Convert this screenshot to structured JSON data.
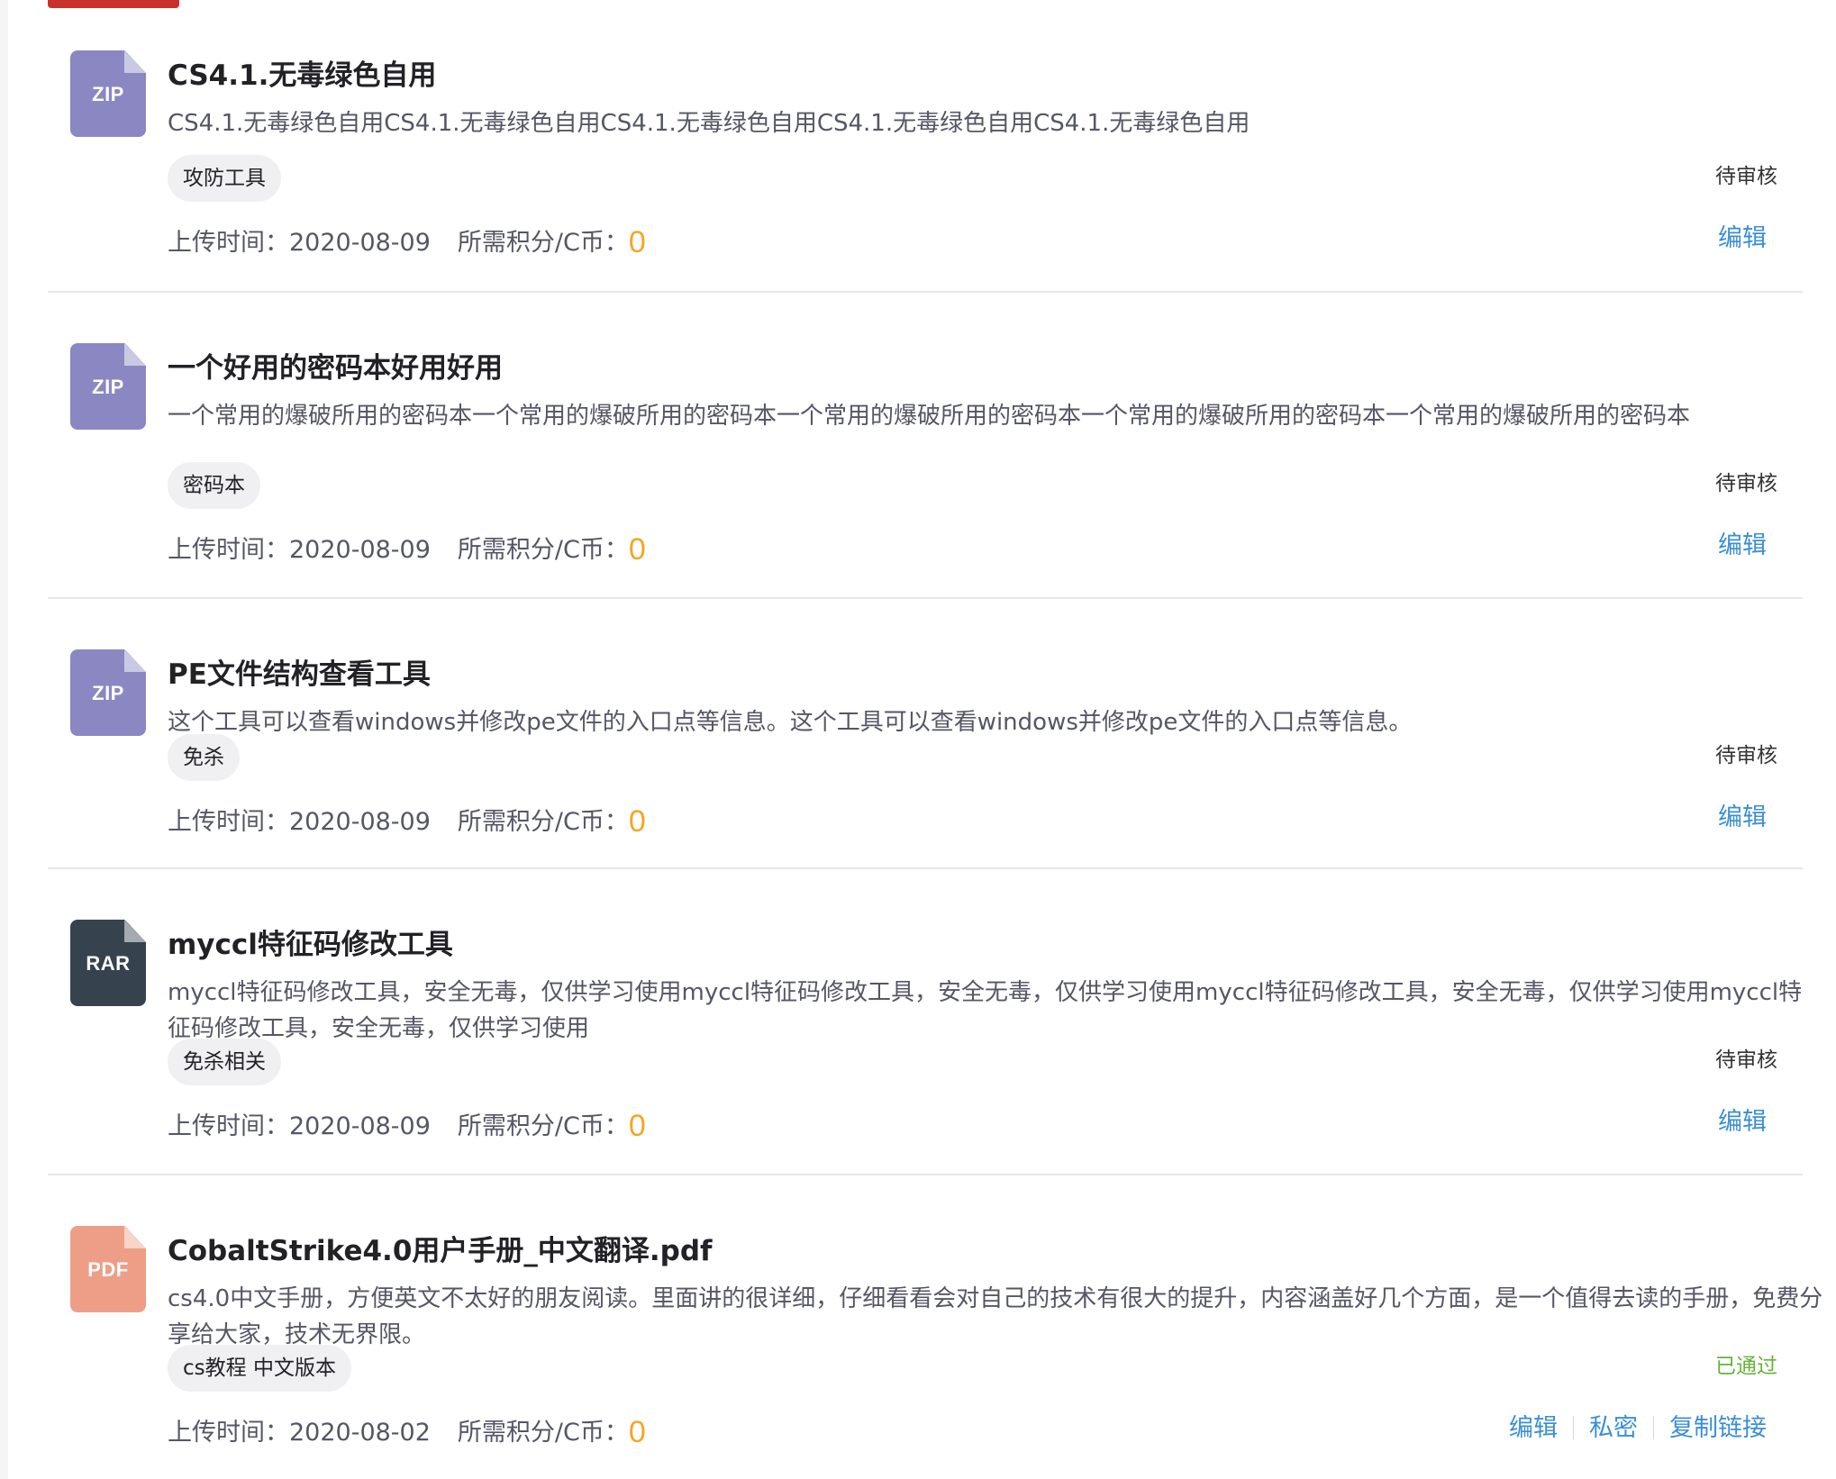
{
  "items": [
    {
      "icon_ext": "ZIP",
      "icon_color": "#8a87c2",
      "title": "CS4.1.无毒绿色自用",
      "description": "CS4.1.无毒绿色自用CS4.1.无毒绿色自用CS4.1.无毒绿色自用CS4.1.无毒绿色自用CS4.1.无毒绿色自用",
      "tag": "攻防工具",
      "upload_label": "上传时间：",
      "upload_date": "2020-08-09",
      "points_label": "所需积分/C币：",
      "points": "0",
      "status": "待审核",
      "actions": [
        "编辑"
      ]
    },
    {
      "icon_ext": "ZIP",
      "icon_color": "#8a87c2",
      "title": "一个好用的密码本好用好用",
      "description": "一个常用的爆破所用的密码本一个常用的爆破所用的密码本一个常用的爆破所用的密码本一个常用的爆破所用的密码本一个常用的爆破所用的密码本",
      "tag": "密码本",
      "upload_label": "上传时间：",
      "upload_date": "2020-08-09",
      "points_label": "所需积分/C币：",
      "points": "0",
      "status": "待审核",
      "actions": [
        "编辑"
      ]
    },
    {
      "icon_ext": "ZIP",
      "icon_color": "#8a87c2",
      "title": "PE文件结构查看工具",
      "description": "这个工具可以查看windows并修改pe文件的入口点等信息。这个工具可以查看windows并修改pe文件的入口点等信息。",
      "tag": "免杀",
      "upload_label": "上传时间：",
      "upload_date": "2020-08-09",
      "points_label": "所需积分/C币：",
      "points": "0",
      "status": "待审核",
      "actions": [
        "编辑"
      ]
    },
    {
      "icon_ext": "RAR",
      "icon_color": "#36434f",
      "title": "myccl特征码修改工具",
      "description": "myccl特征码修改工具，安全无毒，仅供学习使用myccl特征码修改工具，安全无毒，仅供学习使用myccl特征码修改工具，安全无毒，仅供学习使用myccl特征码修改工具，安全无毒，仅供学习使用",
      "tag": "免杀相关",
      "upload_label": "上传时间：",
      "upload_date": "2020-08-09",
      "points_label": "所需积分/C币：",
      "points": "0",
      "status": "待审核",
      "actions": [
        "编辑"
      ]
    },
    {
      "icon_ext": "PDF",
      "icon_color": "#ee9e86",
      "title": "CobaltStrike4.0用户手册_中文翻译.pdf",
      "description": "cs4.0中文手册，方便英文不太好的朋友阅读。里面讲的很详细，仔细看看会对自己的技术有很大的提升，内容涵盖好几个方面，是一个值得去读的手册，免费分享给大家，技术无界限。",
      "tag": "cs教程 中文版本",
      "upload_label": "上传时间：",
      "upload_date": "2020-08-02",
      "points_label": "所需积分/C币：",
      "points": "0",
      "status": "已通过",
      "actions": [
        "编辑",
        "私密",
        "复制链接"
      ]
    }
  ],
  "colors": {
    "accent_link": "#3b8fd4",
    "coin": "#f5a623",
    "approved": "#67b23b",
    "header_tab": "#c9302c"
  }
}
